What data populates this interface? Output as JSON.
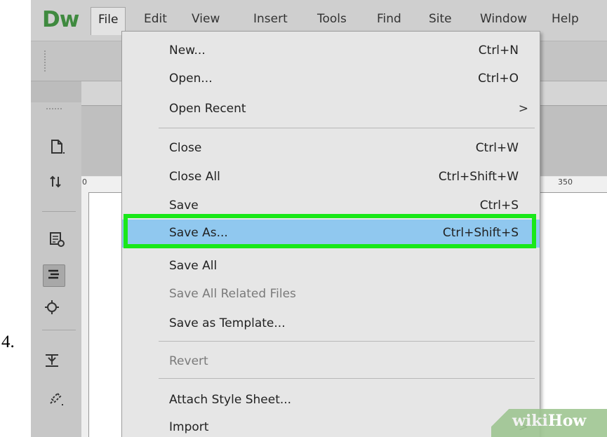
{
  "step_number": "4.",
  "app": {
    "logo": "Dw",
    "menubar": [
      "File",
      "Edit",
      "View",
      "Insert",
      "Tools",
      "Find",
      "Site",
      "Window",
      "Help"
    ],
    "active_menu": "File"
  },
  "file_menu": {
    "groups": [
      [
        {
          "label": "New...",
          "shortcut": "Ctrl+N"
        },
        {
          "label": "Open...",
          "shortcut": "Ctrl+O"
        },
        {
          "label": "Open Recent",
          "submenu_arrow": ">"
        }
      ],
      [
        {
          "label": "Close",
          "shortcut": "Ctrl+W"
        },
        {
          "label": "Close All",
          "shortcut": "Ctrl+Shift+W"
        },
        {
          "label": "Save",
          "shortcut": "Ctrl+S"
        },
        {
          "label": "Save As...",
          "shortcut": "Ctrl+Shift+S",
          "highlighted": true
        },
        {
          "label": "Save All"
        },
        {
          "label": "Save All Related Files",
          "disabled": true
        },
        {
          "label": "Save as Template..."
        }
      ],
      [
        {
          "label": "Revert",
          "disabled": true
        }
      ],
      [
        {
          "label": "Attach Style Sheet..."
        },
        {
          "label": "Import",
          "submenu_arrow": ">"
        }
      ]
    ]
  },
  "ruler": {
    "left_label": "0",
    "mark_label": "350"
  },
  "watermark": {
    "part1": "wiki",
    "part2": "How"
  },
  "colors": {
    "highlight_row": "#90c8ef",
    "callout_border": "#19e819",
    "logo": "#3f8a3f"
  },
  "left_toolbar_icons": [
    "new-document-icon",
    "file-transfer-icon",
    "live-view-icon",
    "code-format-icon",
    "target-icon",
    "expand-icon",
    "link-icon"
  ]
}
